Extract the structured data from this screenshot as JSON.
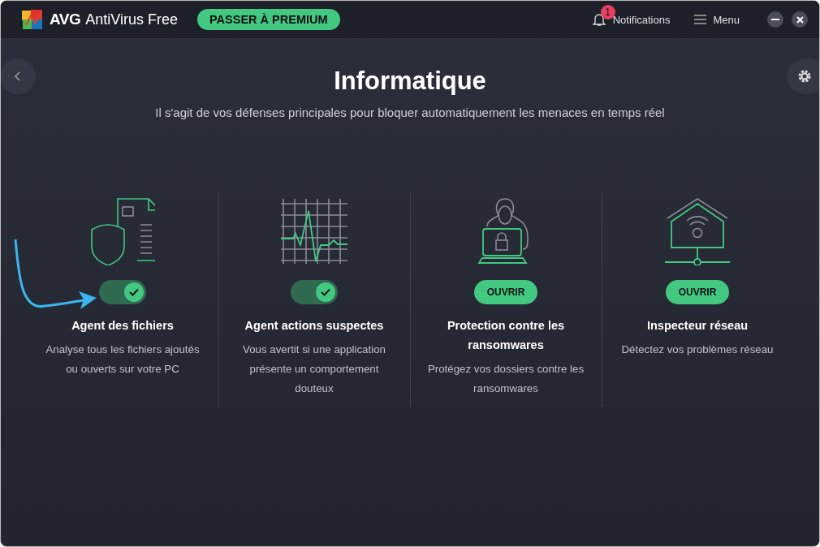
{
  "app": {
    "brand": "AVG",
    "product": "AntiVirus Free",
    "upgrade": "PASSER À PREMIUM"
  },
  "header": {
    "notifications": {
      "label": "Notifications",
      "count": "1"
    },
    "menu": "Menu"
  },
  "page": {
    "title": "Informatique",
    "subtitle": "Il s'agit de vos défenses principales pour bloquer automatiquement les menaces en temps réel"
  },
  "cards": [
    {
      "kind": "toggle",
      "on": true,
      "title": "Agent des fichiers",
      "description": "Analyse tous les fichiers ajoutés ou ouverts sur votre PC"
    },
    {
      "kind": "toggle",
      "on": true,
      "title": "Agent actions suspectes",
      "description": "Vous avertit si une application présente un comportement douteux"
    },
    {
      "kind": "button",
      "button": "OUVRIR",
      "title": "Protection contre les ransomwares",
      "description": "Protégez vos dossiers contre les ransomwares"
    },
    {
      "kind": "button",
      "button": "OUVRIR",
      "title": "Inspecteur réseau",
      "description": "Détectez vos problèmes réseau"
    }
  ]
}
